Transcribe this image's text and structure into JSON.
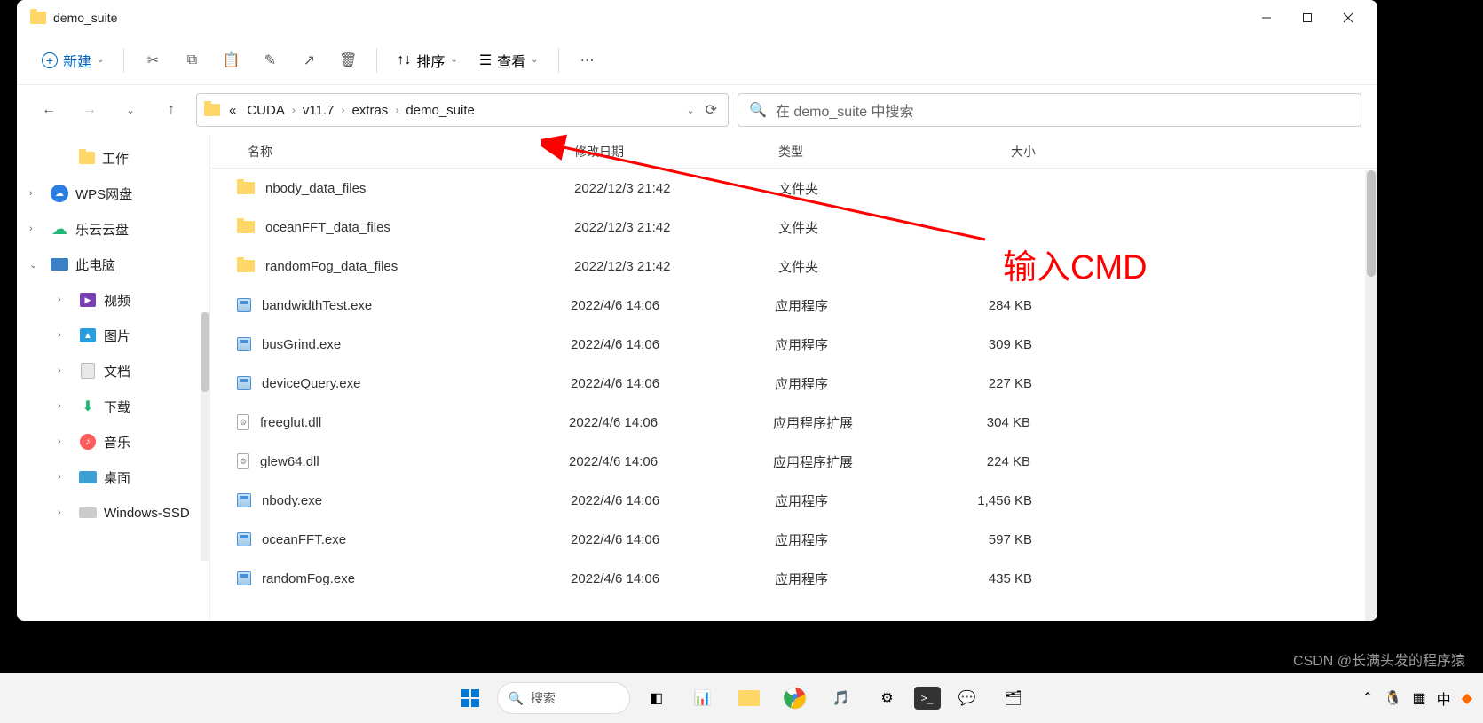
{
  "window": {
    "title": "demo_suite"
  },
  "toolbar": {
    "new_label": "新建",
    "sort_label": "排序",
    "view_label": "查看"
  },
  "breadcrumb": {
    "overflow": "«",
    "items": [
      "CUDA",
      "v11.7",
      "extras",
      "demo_suite"
    ]
  },
  "search": {
    "placeholder": "在 demo_suite 中搜索"
  },
  "sidebar": {
    "items": [
      {
        "label": "工作",
        "icon": "folder",
        "indent": true,
        "chev": ""
      },
      {
        "label": "WPS网盘",
        "icon": "wps",
        "indent": false,
        "chev": "›"
      },
      {
        "label": "乐云云盘",
        "icon": "cloud",
        "indent": false,
        "chev": "›"
      },
      {
        "label": "此电脑",
        "icon": "pc",
        "indent": false,
        "chev": "⌄"
      },
      {
        "label": "视频",
        "icon": "video",
        "indent": true,
        "chev": "›"
      },
      {
        "label": "图片",
        "icon": "pic",
        "indent": true,
        "chev": "›"
      },
      {
        "label": "文档",
        "icon": "doc",
        "indent": true,
        "chev": "›"
      },
      {
        "label": "下载",
        "icon": "download",
        "indent": true,
        "chev": "›"
      },
      {
        "label": "音乐",
        "icon": "music",
        "indent": true,
        "chev": "›"
      },
      {
        "label": "桌面",
        "icon": "desktop",
        "indent": true,
        "chev": "›"
      },
      {
        "label": "Windows-SSD",
        "icon": "drive",
        "indent": true,
        "chev": "›"
      }
    ]
  },
  "columns": {
    "name": "名称",
    "date": "修改日期",
    "type": "类型",
    "size": "大小"
  },
  "files": [
    {
      "name": "nbody_data_files",
      "date": "2022/12/3 21:42",
      "type": "文件夹",
      "size": "",
      "icon": "folder"
    },
    {
      "name": "oceanFFT_data_files",
      "date": "2022/12/3 21:42",
      "type": "文件夹",
      "size": "",
      "icon": "folder"
    },
    {
      "name": "randomFog_data_files",
      "date": "2022/12/3 21:42",
      "type": "文件夹",
      "size": "",
      "icon": "folder"
    },
    {
      "name": "bandwidthTest.exe",
      "date": "2022/4/6 14:06",
      "type": "应用程序",
      "size": "284 KB",
      "icon": "exe"
    },
    {
      "name": "busGrind.exe",
      "date": "2022/4/6 14:06",
      "type": "应用程序",
      "size": "309 KB",
      "icon": "exe"
    },
    {
      "name": "deviceQuery.exe",
      "date": "2022/4/6 14:06",
      "type": "应用程序",
      "size": "227 KB",
      "icon": "exe"
    },
    {
      "name": "freeglut.dll",
      "date": "2022/4/6 14:06",
      "type": "应用程序扩展",
      "size": "304 KB",
      "icon": "dll"
    },
    {
      "name": "glew64.dll",
      "date": "2022/4/6 14:06",
      "type": "应用程序扩展",
      "size": "224 KB",
      "icon": "dll"
    },
    {
      "name": "nbody.exe",
      "date": "2022/4/6 14:06",
      "type": "应用程序",
      "size": "1,456 KB",
      "icon": "exe"
    },
    {
      "name": "oceanFFT.exe",
      "date": "2022/4/6 14:06",
      "type": "应用程序",
      "size": "597 KB",
      "icon": "exe"
    },
    {
      "name": "randomFog.exe",
      "date": "2022/4/6 14:06",
      "type": "应用程序",
      "size": "435 KB",
      "icon": "exe"
    }
  ],
  "annotation": {
    "text": "输入CMD"
  },
  "taskbar": {
    "search": "搜索"
  },
  "watermark": "CSDN @长满头发的程序猿"
}
